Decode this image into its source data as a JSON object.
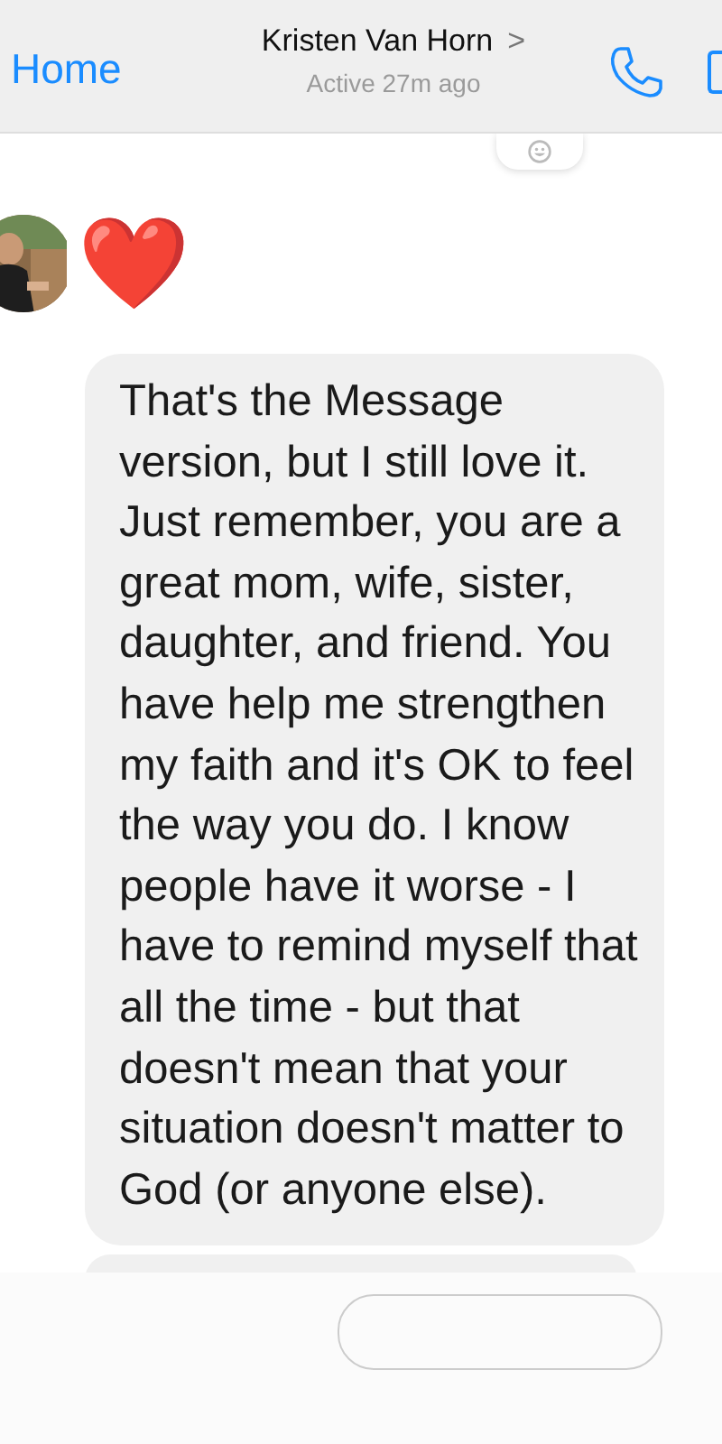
{
  "header": {
    "back": "Home",
    "contact_name": "Kristen Van Horn",
    "chevron": ">",
    "status": "Active 27m ago"
  },
  "messages": [
    {
      "kind": "emoji",
      "text": "❤️"
    },
    {
      "kind": "text",
      "text": "That's the Message version, but I still love it. Just remember, you are a great mom, wife, sister, daughter, and friend. You have help me strengthen my faith and it's OK to feel the way you do. I know people have it worse - I have to remind myself that all the time - but that doesn't mean that your situation doesn't matter to God (or anyone else)."
    }
  ]
}
